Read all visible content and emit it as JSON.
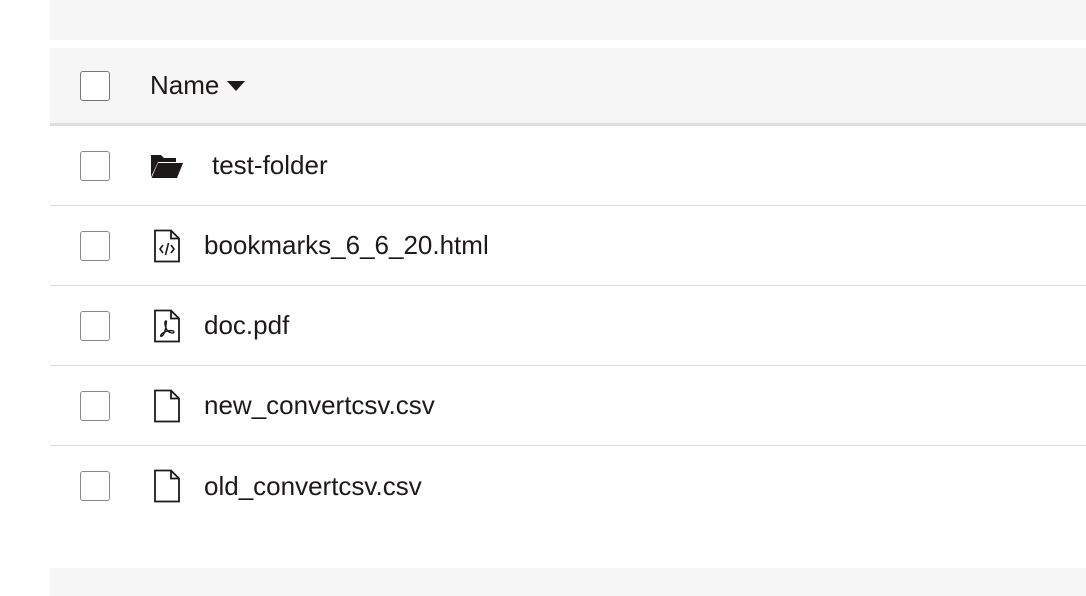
{
  "header": {
    "name_label": "Name"
  },
  "rows": [
    {
      "name": "test-folder",
      "icon": "folder-open-icon",
      "type": "folder"
    },
    {
      "name": "bookmarks_6_6_20.html",
      "icon": "html-file-icon",
      "type": "file"
    },
    {
      "name": "doc.pdf",
      "icon": "pdf-file-icon",
      "type": "file"
    },
    {
      "name": "new_convertcsv.csv",
      "icon": "file-icon",
      "type": "file"
    },
    {
      "name": "old_convertcsv.csv",
      "icon": "file-icon",
      "type": "file"
    }
  ],
  "colors": {
    "header_background": "#f5f6f5",
    "text": "#1e1919",
    "divider": "#dcdcdc"
  }
}
